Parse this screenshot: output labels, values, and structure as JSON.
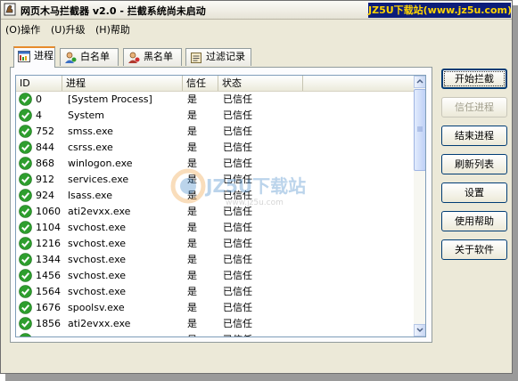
{
  "titlebar": {
    "title": "网页木马拦截器 v2.0 - 拦截系统尚未启动",
    "watermark": "JZ5U下载站(www.jz5u.com)"
  },
  "menu": [
    {
      "label": "(O)操作"
    },
    {
      "label": "(U)升级"
    },
    {
      "label": "(H)帮助"
    }
  ],
  "tabs": [
    {
      "label": "进程",
      "icon": "process-list-icon",
      "active": true
    },
    {
      "label": "白名单",
      "icon": "whitelist-user-icon",
      "active": false
    },
    {
      "label": "黑名单",
      "icon": "blacklist-user-icon",
      "active": false
    },
    {
      "label": "过滤记录",
      "icon": "filter-log-icon",
      "active": false
    }
  ],
  "table": {
    "columns": [
      "ID",
      "进程",
      "信任",
      "状态"
    ],
    "rows": [
      {
        "id": "0",
        "process": "[System Process]",
        "trust": "是",
        "status": "已信任"
      },
      {
        "id": "4",
        "process": "System",
        "trust": "是",
        "status": "已信任"
      },
      {
        "id": "752",
        "process": "smss.exe",
        "trust": "是",
        "status": "已信任"
      },
      {
        "id": "844",
        "process": "csrss.exe",
        "trust": "是",
        "status": "已信任"
      },
      {
        "id": "868",
        "process": "winlogon.exe",
        "trust": "是",
        "status": "已信任"
      },
      {
        "id": "912",
        "process": "services.exe",
        "trust": "是",
        "status": "已信任"
      },
      {
        "id": "924",
        "process": "lsass.exe",
        "trust": "是",
        "status": "已信任"
      },
      {
        "id": "1060",
        "process": "ati2evxx.exe",
        "trust": "是",
        "status": "已信任"
      },
      {
        "id": "1104",
        "process": "svchost.exe",
        "trust": "是",
        "status": "已信任"
      },
      {
        "id": "1216",
        "process": "svchost.exe",
        "trust": "是",
        "status": "已信任"
      },
      {
        "id": "1344",
        "process": "svchost.exe",
        "trust": "是",
        "status": "已信任"
      },
      {
        "id": "1456",
        "process": "svchost.exe",
        "trust": "是",
        "status": "已信任"
      },
      {
        "id": "1564",
        "process": "svchost.exe",
        "trust": "是",
        "status": "已信任"
      },
      {
        "id": "1676",
        "process": "spoolsv.exe",
        "trust": "是",
        "status": "已信任"
      },
      {
        "id": "1856",
        "process": "ati2evxx.exe",
        "trust": "是",
        "status": "已信任"
      },
      {
        "id": "",
        "process": "",
        "trust": "是",
        "status": "已信任"
      }
    ]
  },
  "buttons": [
    {
      "label": "开始拦截",
      "state": "default"
    },
    {
      "label": "信任进程",
      "state": "disabled"
    },
    {
      "label": "结束进程",
      "state": "normal"
    },
    {
      "label": "刷新列表",
      "state": "normal"
    },
    {
      "label": "设置",
      "state": "normal"
    },
    {
      "label": "使用帮助",
      "state": "normal"
    },
    {
      "label": "关于软件",
      "state": "normal"
    }
  ],
  "watermark_overlay": {
    "brand": "JZ5U下载站",
    "url": "www.jz5u.com"
  },
  "colors": {
    "check_green": "#2e9e2e",
    "title_badge_bg": "#0c1d7a",
    "title_badge_fg": "#ffd400",
    "active_tab_accent": "#e68b2c"
  }
}
